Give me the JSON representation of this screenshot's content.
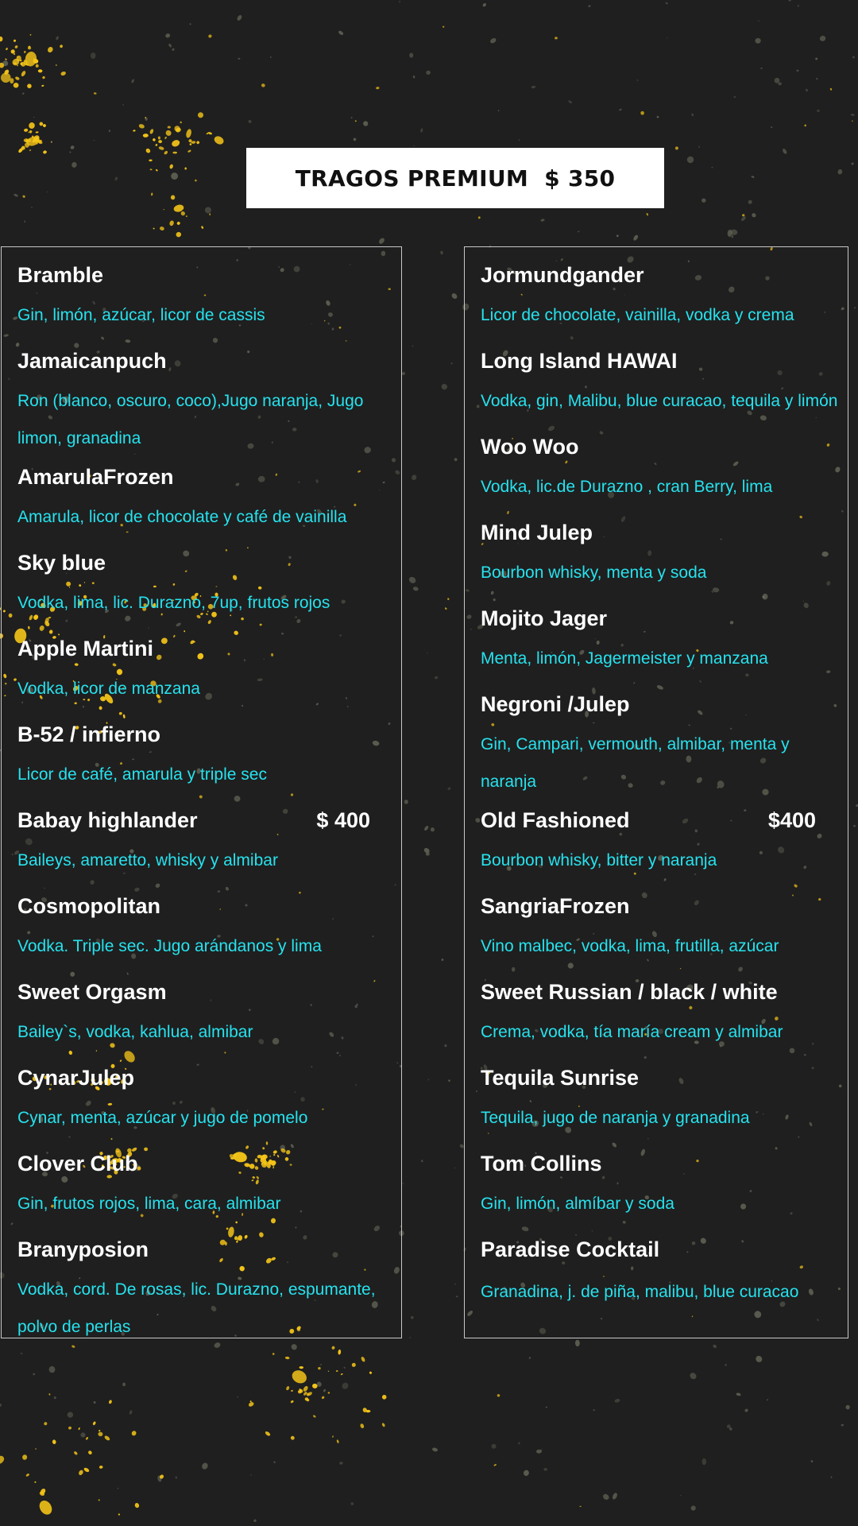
{
  "title": "TRAGOS PREMIUM  $ 350",
  "colors": {
    "background": "#1f1f1f",
    "drink_name": "#ffffff",
    "description": "#26e2ee",
    "frame": "#c8c8c8",
    "speckle_yellow": "#f5c518",
    "speckle_gray": "#6f7060"
  },
  "left_column": [
    {
      "name": "Bramble",
      "price": "",
      "desc": "Gin, limón, azúcar, licor de cassis"
    },
    {
      "name": "Jamaicanpuch",
      "price": "",
      "desc": "Ron (blanco, oscuro, coco),Jugo naranja, Jugo limon, granadina"
    },
    {
      "name": "AmarulaFrozen",
      "price": "",
      "desc": "Amarula, licor de chocolate y café de vainilla"
    },
    {
      "name": "Sky blue",
      "price": "",
      "desc": "Vodka, lima, lic. Durazno, 7up, frutos rojos"
    },
    {
      "name": "Apple Martini",
      "price": "",
      "desc": "Vodka, licor de manzana"
    },
    {
      "name": "B-52 / infierno",
      "price": "",
      "desc": "Licor de café, amarula y triple sec"
    },
    {
      "name": "Babay highlander",
      "price": "$ 400",
      "desc": "Baileys, amaretto, whisky y almibar"
    },
    {
      "name": "Cosmopolitan",
      "price": "",
      "desc": "Vodka. Triple sec. Jugo arándanos y lima"
    },
    {
      "name": "Sweet Orgasm",
      "price": "",
      "desc": "Bailey`s, vodka, kahlua, almibar"
    },
    {
      "name": "CynarJulep",
      "price": "",
      "desc": "Cynar, menta, azúcar y jugo de pomelo"
    },
    {
      "name": "Clover Club",
      "price": "",
      "desc": "Gin, frutos rojos, lima, cara, almibar"
    },
    {
      "name": "Branyposion",
      "price": "",
      "desc": "Vodka, cord. De rosas, lic. Durazno, espumante, polvo de perlas"
    }
  ],
  "right_column": [
    {
      "name": "Jormundgander",
      "price": "",
      "desc": "Licor de chocolate, vainilla, vodka y crema"
    },
    {
      "name": "Long Island HAWAI",
      "price": "",
      "desc": "Vodka, gin, Malibu, blue curacao, tequila y limón"
    },
    {
      "name": "Woo Woo",
      "price": "",
      "desc": "Vodka, lic.de Durazno , cran Berry, lima"
    },
    {
      "name": "Mind Julep",
      "price": "",
      "desc": "Bourbon whisky, menta y soda"
    },
    {
      "name": "Mojito Jager",
      "price": "",
      "desc": "Menta, limón, Jagermeister y manzana"
    },
    {
      "name": "Negroni /Julep",
      "price": "",
      "desc": "Gin, Campari, vermouth, almibar, menta y naranja"
    },
    {
      "name": "Old Fashioned",
      "price": "$400",
      "desc": "Bourbon whisky, bitter y naranja"
    },
    {
      "name": "SangriaFrozen",
      "price": "",
      "desc": "Vino malbec, vodka, lima, frutilla, azúcar"
    },
    {
      "name": "Sweet Russian / black / white",
      "price": "",
      "desc": "Crema, vodka, tía maría cream y almibar"
    },
    {
      "name": "Tequila Sunrise",
      "price": "",
      "desc": "Tequila, jugo de naranja y granadina"
    },
    {
      "name": "Tom Collins",
      "price": "",
      "desc": "Gin, limón, almíbar y soda"
    },
    {
      "name": "Paradise Cocktail",
      "price": "",
      "desc": "Granadina, j. de piña, malibu, blue curacao"
    }
  ]
}
